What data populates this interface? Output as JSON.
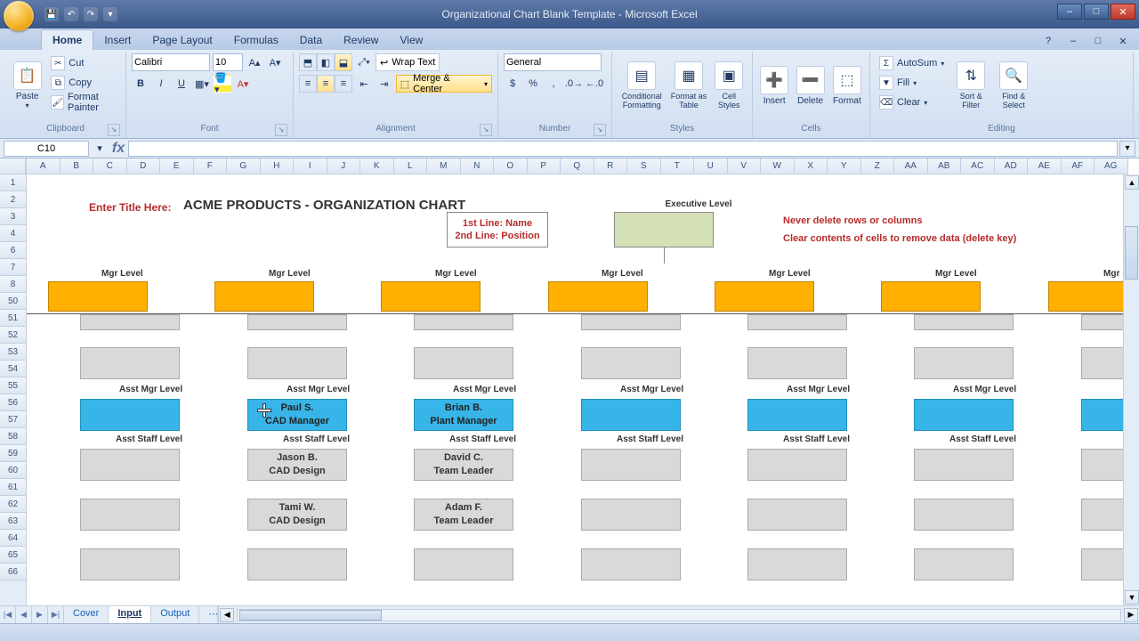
{
  "window": {
    "title": "Organizational Chart Blank Template - Microsoft Excel"
  },
  "qat": {
    "save": "💾",
    "undo": "↶",
    "redo": "↷",
    "more": "▾"
  },
  "winbtns": {
    "min": "–",
    "max": "□",
    "close": "✕"
  },
  "tabs": [
    "Home",
    "Insert",
    "Page Layout",
    "Formulas",
    "Data",
    "Review",
    "View"
  ],
  "ribbon": {
    "clipboard": {
      "label": "Clipboard",
      "paste": "Paste",
      "cut": "Cut",
      "copy": "Copy",
      "fp": "Format Painter"
    },
    "font": {
      "label": "Font",
      "family": "Calibri",
      "size": "10",
      "bold": "B",
      "italic": "I",
      "underline": "U"
    },
    "alignment": {
      "label": "Alignment",
      "wrap": "Wrap Text",
      "merge": "Merge & Center"
    },
    "number": {
      "label": "Number",
      "format": "General",
      "currency": "$",
      "percent": "%",
      "comma": ",",
      "incdec": "⯅",
      "decdec": "⯆"
    },
    "styles": {
      "label": "Styles",
      "cond": "Conditional Formatting",
      "table": "Format as Table",
      "cell": "Cell Styles"
    },
    "cells": {
      "label": "Cells",
      "insert": "Insert",
      "delete": "Delete",
      "format": "Format"
    },
    "editing": {
      "label": "Editing",
      "sum": "AutoSum",
      "fill": "Fill",
      "clear": "Clear",
      "sort": "Sort & Filter",
      "find": "Find & Select"
    }
  },
  "namebox": "C10",
  "columns": [
    "A",
    "B",
    "C",
    "D",
    "E",
    "F",
    "G",
    "H",
    "I",
    "J",
    "K",
    "L",
    "M",
    "N",
    "O",
    "P",
    "Q",
    "R",
    "S",
    "T",
    "U",
    "V",
    "W",
    "X",
    "Y",
    "Z",
    "AA",
    "AB",
    "AC",
    "AD",
    "AE",
    "AF",
    "AG"
  ],
  "rows_top": [
    "1",
    "2",
    "3",
    "4",
    "6",
    "7",
    "8"
  ],
  "rows_bot": [
    "50",
    "51",
    "52",
    "53",
    "54",
    "55",
    "56",
    "57",
    "58",
    "59",
    "60",
    "61",
    "62",
    "63",
    "64",
    "65",
    "66"
  ],
  "sheet": {
    "title_prompt": "Enter Title Here:",
    "title": "ACME PRODUCTS - ORGANIZATION CHART",
    "legend_l1": "1st Line: Name",
    "legend_l2": "2nd Line: Position",
    "exec_label": "Executive Level",
    "warn1": "Never delete rows or columns",
    "warn2": "Clear contents of cells to remove data (delete key)",
    "mgr_label": "Mgr Level",
    "asst_mgr_label": "Asst Mgr Level",
    "asst_staff_label": "Asst Staff Level",
    "col2_mgr_name": "Paul S.",
    "col2_mgr_pos": "CAD Manager",
    "col2_s1_name": "Jason B.",
    "col2_s1_pos": "CAD Design",
    "col2_s2_name": "Tami W.",
    "col2_s2_pos": "CAD Design",
    "col3_mgr_name": "Brian B.",
    "col3_mgr_pos": "Plant Manager",
    "col3_s1_name": "David C.",
    "col3_s1_pos": "Team Leader",
    "col3_s2_name": "Adam F.",
    "col3_s2_pos": "Team Leader"
  },
  "sheettabs": {
    "nav": [
      "|◀",
      "◀",
      "▶",
      "▶|"
    ],
    "cover": "Cover",
    "input": "Input",
    "output": "Output",
    "new": "⋯"
  }
}
